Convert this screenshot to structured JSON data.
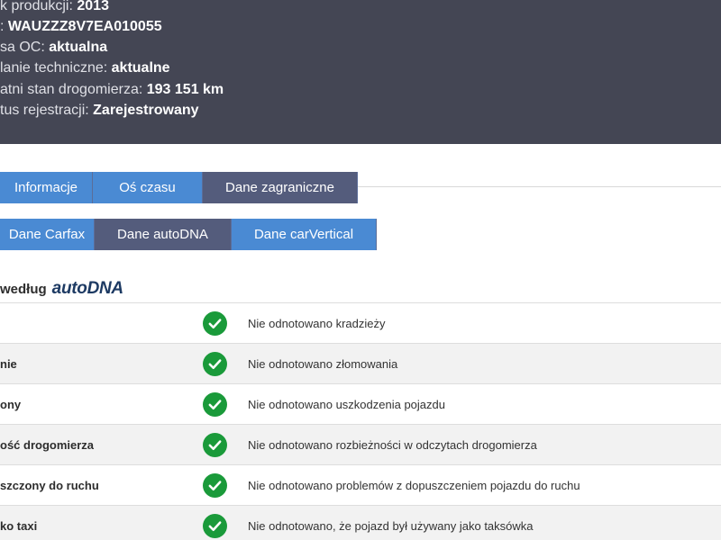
{
  "header": {
    "lines": [
      {
        "label": "k produkcji: ",
        "value": "2013"
      },
      {
        "label": ": ",
        "value": "WAUZZZ8V7EA010055"
      },
      {
        "label": "sa OC: ",
        "value": "aktualna"
      },
      {
        "label": "lanie techniczne: ",
        "value": "aktualne"
      },
      {
        "label": "atni stan drogomierza: ",
        "value": "193 151 km"
      },
      {
        "label": "tus rejestracji: ",
        "value": "Zarejestrowany"
      }
    ]
  },
  "tabs_row1": [
    {
      "label": "Informacje",
      "active": false
    },
    {
      "label": "Oś czasu",
      "active": false
    },
    {
      "label": "Dane zagraniczne",
      "active": true
    }
  ],
  "tabs_row2": [
    {
      "label": "Dane Carfax",
      "active": false
    },
    {
      "label": "Dane autoDNA",
      "active": true
    },
    {
      "label": "Dane carVertical",
      "active": false
    }
  ],
  "section": {
    "prefix": "według",
    "brand": "autoDNA"
  },
  "rows": [
    {
      "name": "",
      "status": "check-icon",
      "description": "Nie odnotowano kradzieży"
    },
    {
      "name": "nie",
      "status": "check-icon",
      "description": "Nie odnotowano złomowania"
    },
    {
      "name": "ony",
      "status": "check-icon",
      "description": "Nie odnotowano uszkodzenia pojazdu"
    },
    {
      "name": "ość drogomierza",
      "status": "check-icon",
      "description": "Nie odnotowano rozbieżności w odczytach drogomierza"
    },
    {
      "name": "szczony do ruchu",
      "status": "check-icon",
      "description": "Nie odnotowano problemów z dopuszczeniem pojazdu do ruchu"
    },
    {
      "name": "ko taxi",
      "status": "check-icon",
      "description": "Nie odnotowano, że pojazd był używany jako taksówka"
    }
  ],
  "colors": {
    "header_bg": "#444654",
    "tab_blue": "#4a8ad3",
    "tab_active": "#545c7c",
    "check_green": "#1a9a3a"
  }
}
